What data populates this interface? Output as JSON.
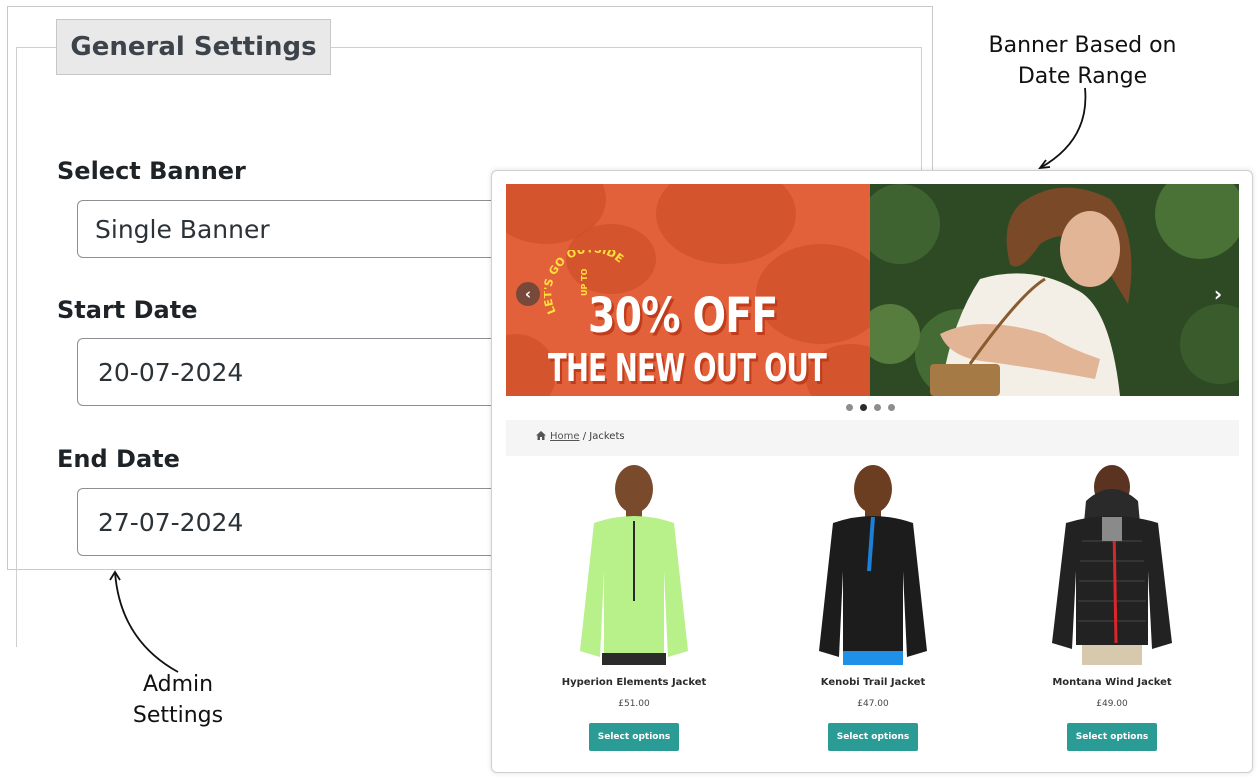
{
  "admin": {
    "legend": "General Settings",
    "fields": [
      {
        "label": "Select Banner",
        "value": "Single Banner"
      },
      {
        "label": "Start Date",
        "value": "20-07-2024"
      },
      {
        "label": "End Date",
        "value": "27-07-2024"
      }
    ]
  },
  "annotations": {
    "banner_line1": "Banner Based on",
    "banner_line2": "Date Range",
    "admin_line1": "Admin",
    "admin_line2": "Settings"
  },
  "store": {
    "banner": {
      "arc_text": "LET'S GO OUTSIDE",
      "upto": "UP TO",
      "headline": "30% OFF",
      "subline": "THE NEW OUT OUT",
      "prev_icon": "chevron-left-icon",
      "next_icon": "chevron-right-icon",
      "slides": 4,
      "active_slide": 2
    },
    "breadcrumb": {
      "home_icon": "home-icon",
      "home": "Home",
      "separator": "/",
      "current": "Jackets"
    },
    "products": [
      {
        "name": "Hyperion Elements Jacket",
        "price": "£51.00",
        "button": "Select options",
        "color": "#b8f08a"
      },
      {
        "name": "Kenobi Trail Jacket",
        "price": "£47.00",
        "button": "Select options",
        "color": "#1c1c1c"
      },
      {
        "name": "Montana Wind Jacket",
        "price": "£49.00",
        "button": "Select options",
        "color": "#222222"
      }
    ],
    "button_color": "#2a9c95"
  }
}
